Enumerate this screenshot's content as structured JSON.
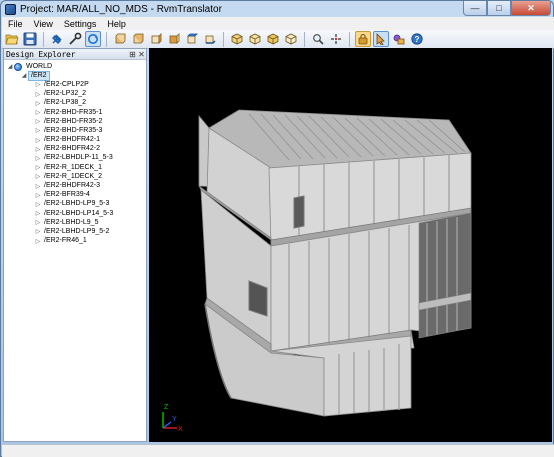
{
  "window": {
    "title": "Project: MAR/ALL_NO_MDS - RvmTranslator"
  },
  "menu": [
    "File",
    "View",
    "Settings",
    "Help"
  ],
  "toolbar": {
    "buttons": [
      "open-icon",
      "save-icon",
      "pin-icon",
      "wrench-icon",
      "orbit-icon",
      "view-front-icon",
      "view-back-icon",
      "view-left-icon",
      "view-right-icon",
      "view-top-icon",
      "view-bottom-icon",
      "view-iso1-icon",
      "view-iso2-icon",
      "view-iso3-icon",
      "view-iso4-icon",
      "zoom-icon",
      "zoom-fit-icon",
      "lock-icon",
      "select-icon",
      "tools-icon",
      "help-icon"
    ],
    "active": [
      "lock-icon"
    ],
    "selected": [
      "orbit-icon",
      "select-icon"
    ]
  },
  "explorer": {
    "title": "Design Explorer",
    "pin_glyph": "⊞",
    "close_glyph": "✕",
    "root": "WORLD",
    "selected": "/ER2",
    "items": [
      "/ER2-CPLP2P",
      "/ER2-LP32_2",
      "/ER2-LP38_2",
      "/ER2-BHD-FR35-1",
      "/ER2-BHD-FR35-2",
      "/ER2-BHD-FR35-3",
      "/ER2-BHDFR42-1",
      "/ER2-BHDFR42-2",
      "/ER2-LBHDLP-11_5-3",
      "/ER2-R_1DECK_1",
      "/ER2-R_1DECK_2",
      "/ER2-BHDFR42-3",
      "/ER2-BFR39-4",
      "/ER2-LBHD-LP9_5-3",
      "/ER2-LBHD-LP14_5-3",
      "/ER2-LBHD-L9_5",
      "/ER2-LBHD-LP9_5-2",
      "/ER2-FR46_1"
    ]
  },
  "axes": {
    "x": "X",
    "y": "Y",
    "z": "Z"
  },
  "colors": {
    "viewport_bg": "#000000",
    "model_light": "#d4d4d4",
    "model_mid": "#bfbfbf",
    "model_dark": "#9a9a9a"
  }
}
